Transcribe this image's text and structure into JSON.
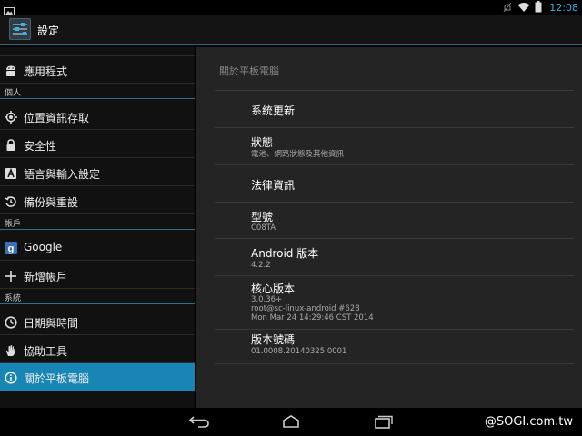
{
  "status_bar": {
    "time": "12:08"
  },
  "action_bar": {
    "title": "設定",
    "icon": "settings-sliders-icon"
  },
  "sidebar": {
    "items": [
      {
        "id": "apps",
        "label": "應用程式",
        "icon": "android-icon"
      },
      {
        "id": "header-personal",
        "label": "個人",
        "header": true
      },
      {
        "id": "location",
        "label": "位置資訊存取",
        "icon": "location-target-icon"
      },
      {
        "id": "security",
        "label": "安全性",
        "icon": "lock-icon"
      },
      {
        "id": "language",
        "label": "語言與輸入設定",
        "icon": "keyboard-a-icon"
      },
      {
        "id": "backup",
        "label": "備份與重設",
        "icon": "backup-restore-icon"
      },
      {
        "id": "header-accounts",
        "label": "帳戶",
        "header": true
      },
      {
        "id": "google",
        "label": "Google",
        "icon": "google-g-icon"
      },
      {
        "id": "add-account",
        "label": "新增帳戶",
        "icon": "plus-icon"
      },
      {
        "id": "header-system",
        "label": "系統",
        "header": true
      },
      {
        "id": "datetime",
        "label": "日期與時間",
        "icon": "clock-icon"
      },
      {
        "id": "accessibility",
        "label": "協助工具",
        "icon": "hand-icon"
      },
      {
        "id": "about",
        "label": "關於平板電腦",
        "icon": "info-icon",
        "active": true
      }
    ]
  },
  "content": {
    "header": "關於平板電腦",
    "prefs": [
      {
        "id": "system-update",
        "title": "系統更新",
        "summary": []
      },
      {
        "id": "status",
        "title": "狀態",
        "summary": [
          "電池、網路狀態及其他資訊"
        ]
      },
      {
        "id": "legal",
        "title": "法律資訊",
        "summary": []
      },
      {
        "id": "model",
        "title": "型號",
        "summary": [
          "C08TA"
        ]
      },
      {
        "id": "android-version",
        "title": "Android 版本",
        "summary": [
          "4.2.2"
        ]
      },
      {
        "id": "kernel-version",
        "title": "核心版本",
        "summary": [
          "3.0.36+",
          "root@sc-linux-android #628",
          "Mon Mar 24 14:29:46 CST 2014"
        ]
      },
      {
        "id": "build-number",
        "title": "版本號碼",
        "summary": [
          "01.0008.20140325.0001"
        ]
      }
    ]
  },
  "nav_bar": {
    "back": "back-icon",
    "home": "home-icon",
    "recents": "recents-icon"
  },
  "watermark": "@SOGI.com.tw",
  "colors": {
    "accent": "#33b5e5",
    "active_item": "#1786b5",
    "content_bg": "#242424",
    "sidebar_bg": "#111111"
  }
}
